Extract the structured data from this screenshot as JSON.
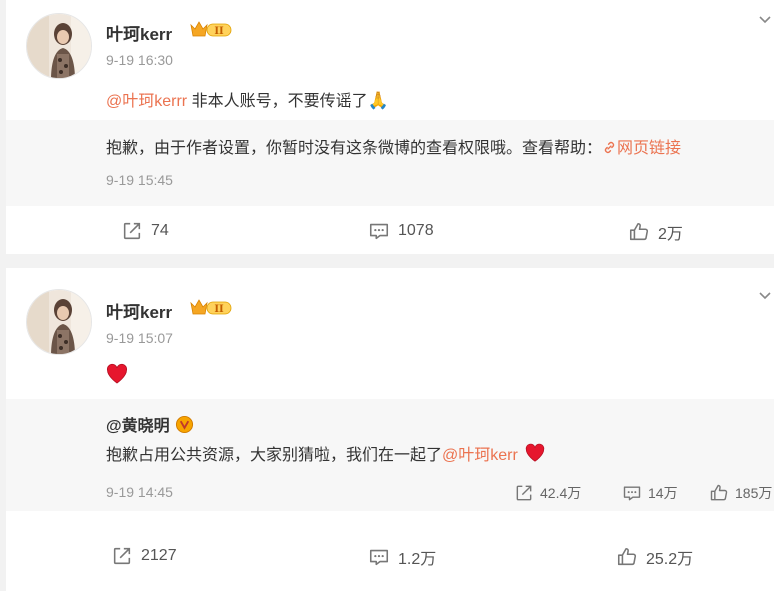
{
  "posts": [
    {
      "author": "叶珂kerr",
      "time": "9-19 16:30",
      "mention": "@叶珂kerrr",
      "text": " 非本人账号，不要传谣了",
      "retweet": {
        "notice": "抱歉，由于作者设置，你暂时没有这条微博的查看权限哦。查看帮助：",
        "link": "网页链接",
        "time": "9-19 15:45"
      },
      "stats": {
        "reposts": "74",
        "comments": "1078",
        "likes": "2万"
      }
    },
    {
      "author": "叶珂kerr",
      "time": "9-19 15:07",
      "retweet": {
        "author": "@黄晓明",
        "text": "抱歉占用公共资源，大家别猜啦，我们在一起了",
        "mention": "@叶珂kerr",
        "time": "9-19 14:45",
        "stats": {
          "reposts": "42.4万",
          "comments": "14万",
          "likes": "185万"
        }
      },
      "stats": {
        "reposts": "2127",
        "comments": "1.2万",
        "likes": "25.2万"
      }
    }
  ],
  "colors": {
    "accent": "#eb7350",
    "background": "#f2f2f2",
    "retweet_bg": "#f7f7f7"
  }
}
